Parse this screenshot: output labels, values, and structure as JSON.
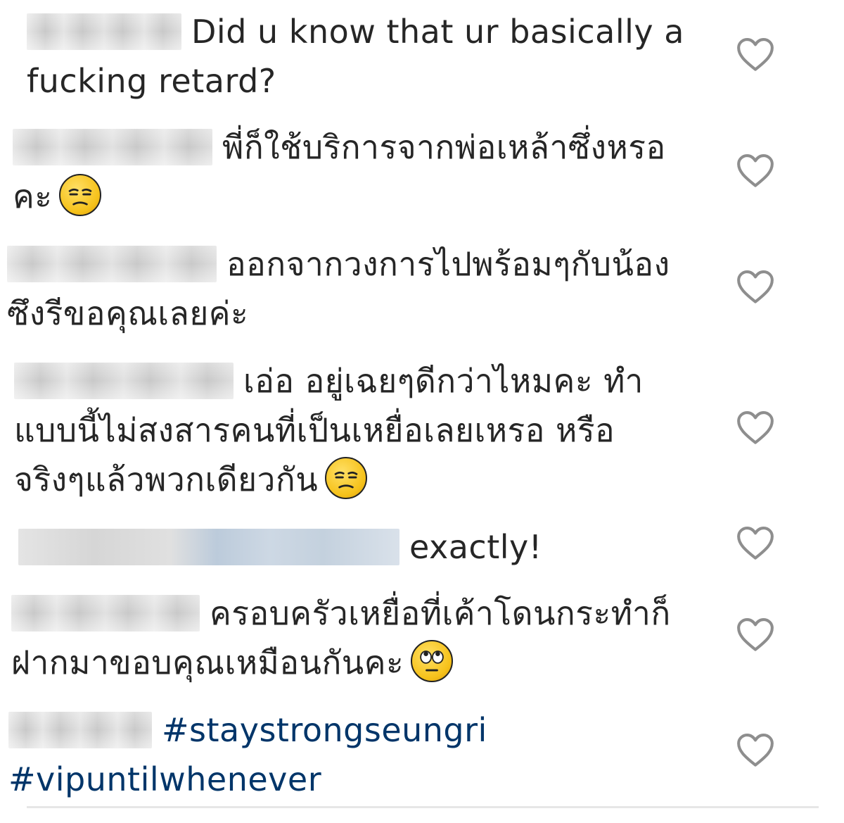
{
  "comments": [
    {
      "text": "Did u know that ur basically a fucking retard?",
      "emoji": "",
      "like_icon": "heart-outline-icon"
    },
    {
      "text": "พี่ก็ใช้บริการจากพ่อเหล้าซึ่งหรอคะ",
      "emoji": "unamused-face-emoji",
      "like_icon": "heart-outline-icon"
    },
    {
      "text": "ออกจากวงการไปพร้อมๆกับน้องซึงรีขอคุณเลยค่ะ",
      "emoji": "",
      "like_icon": "heart-outline-icon"
    },
    {
      "text": "เอ่อ อยู่เฉยๆดีกว่าไหมคะ ทำแบบนี้ไม่สงสารคนที่เป็นเหยื่อเลยเหรอ หรือจริงๆแล้วพวกเดียวกัน",
      "emoji": "unamused-face-emoji",
      "like_icon": "heart-outline-icon"
    },
    {
      "text": "exactly!",
      "emoji": "",
      "like_icon": "heart-outline-icon"
    },
    {
      "text": "ครอบครัวเหยื่อที่เค้าโดนกระทำก็ฝากมาขอบคุณเหมือนกันคะ",
      "emoji": "face-with-rolling-eyes-emoji",
      "like_icon": "heart-outline-icon"
    },
    {
      "text": "#staystrongseungri #vipuntilwhenever",
      "emoji": "",
      "like_icon": "heart-outline-icon"
    }
  ],
  "colors": {
    "text": "#262626",
    "hashtag": "#003569",
    "heart_stroke": "#8e8e8e",
    "emoji_fill": "#f6c21b"
  }
}
